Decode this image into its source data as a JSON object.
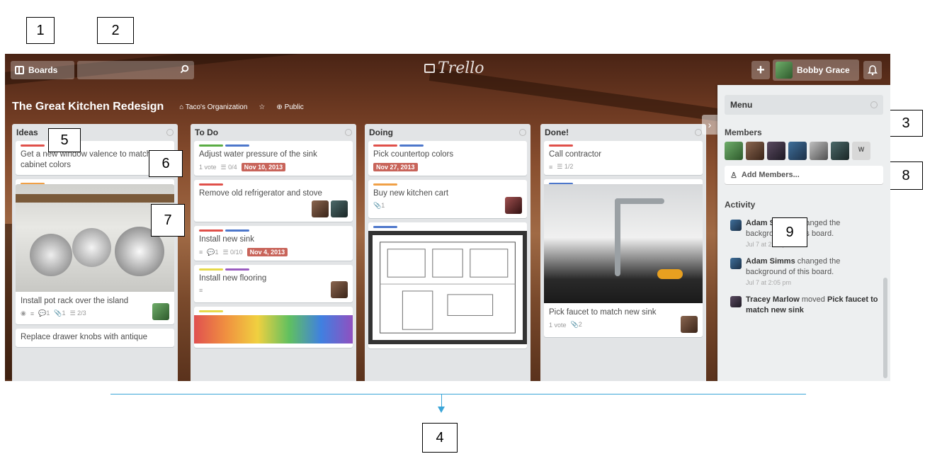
{
  "callouts": [
    "1",
    "2",
    "3",
    "4",
    "5",
    "6",
    "7",
    "8",
    "9"
  ],
  "app": {
    "boards_label": "Boards",
    "logo_text": "Trello",
    "plus_label": "+",
    "user_name": "Bobby Grace"
  },
  "board": {
    "title": "The Great Kitchen Redesign",
    "organization": "Taco's Organization",
    "visibility": "Public"
  },
  "lists": [
    {
      "title": "Ideas",
      "cards": [
        {
          "labels": [
            "red"
          ],
          "text": "Get a new window valence to match the cabinet colors"
        },
        {
          "labels": [
            "orange"
          ],
          "image": "pot-rack-photo",
          "text": "Install pot rack over the island",
          "badges": [
            "◉",
            "≡",
            "💬1",
            "📎1",
            "☰ 2/3"
          ]
        },
        {
          "text": "Replace drawer knobs with antique"
        }
      ]
    },
    {
      "title": "To Do",
      "cards": [
        {
          "labels": [
            "green",
            "blue"
          ],
          "text": "Adjust water pressure of the sink",
          "badges": [
            "1 vote",
            "☰ 0/4"
          ],
          "due": "Nov 10, 2013"
        },
        {
          "labels": [
            "red"
          ],
          "text": "Remove old refrigerator and stove"
        },
        {
          "labels": [
            "red",
            "blue"
          ],
          "text": "Install new sink",
          "badges": [
            "≡",
            "💬1",
            "☰ 0/10"
          ],
          "due": "Nov 4, 2013"
        },
        {
          "labels": [
            "yellow",
            "purple"
          ],
          "text": "Install new flooring",
          "badges": [
            "≡"
          ]
        }
      ]
    },
    {
      "title": "Doing",
      "cards": [
        {
          "labels": [
            "red",
            "blue"
          ],
          "text": "Pick countertop colors",
          "due": "Nov 27, 2013"
        },
        {
          "labels": [
            "orange"
          ],
          "text": "Buy new kitchen cart",
          "badges": [
            "📎1"
          ]
        },
        {
          "labels": [
            "blue"
          ],
          "image": "floor-plan"
        }
      ]
    },
    {
      "title": "Done!",
      "cards": [
        {
          "labels": [
            "red"
          ],
          "text": "Call contractor",
          "badges": [
            "≡",
            "☰ 1/2"
          ]
        },
        {
          "labels": [
            "blue"
          ],
          "image": "faucet-photo",
          "text": "Pick faucet to match new sink",
          "badges": [
            "1 vote",
            "📎2"
          ]
        }
      ]
    }
  ],
  "sidebar": {
    "menu_title": "Menu",
    "members_title": "Members",
    "extra_member_initial": "W",
    "add_members_label": "Add Members...",
    "activity_title": "Activity",
    "activity": [
      {
        "actor": "Adam Simms",
        "action": "changed the background of this board.",
        "time": "Jul 7 at 2:06 pm"
      },
      {
        "actor": "Adam Simms",
        "action": "changed the background of this board.",
        "time": "Jul 7 at 2:05 pm"
      },
      {
        "actor": "Tracey Marlow",
        "action": "moved",
        "object": "Pick faucet to match new sink"
      }
    ]
  },
  "icons": [
    "board-icon",
    "search-icon",
    "plus-icon",
    "bell-icon",
    "star-icon",
    "globe-icon",
    "org-icon",
    "person-icon"
  ],
  "colors": {
    "label_red": "#e0504a",
    "label_blue": "#4d77cb",
    "label_green": "#5aac44",
    "label_orange": "#f0a046",
    "label_yellow": "#e6d94a",
    "label_purple": "#9a5cc0",
    "due_badge": "#c8645a",
    "annotation_line": "#3aa5d8"
  }
}
